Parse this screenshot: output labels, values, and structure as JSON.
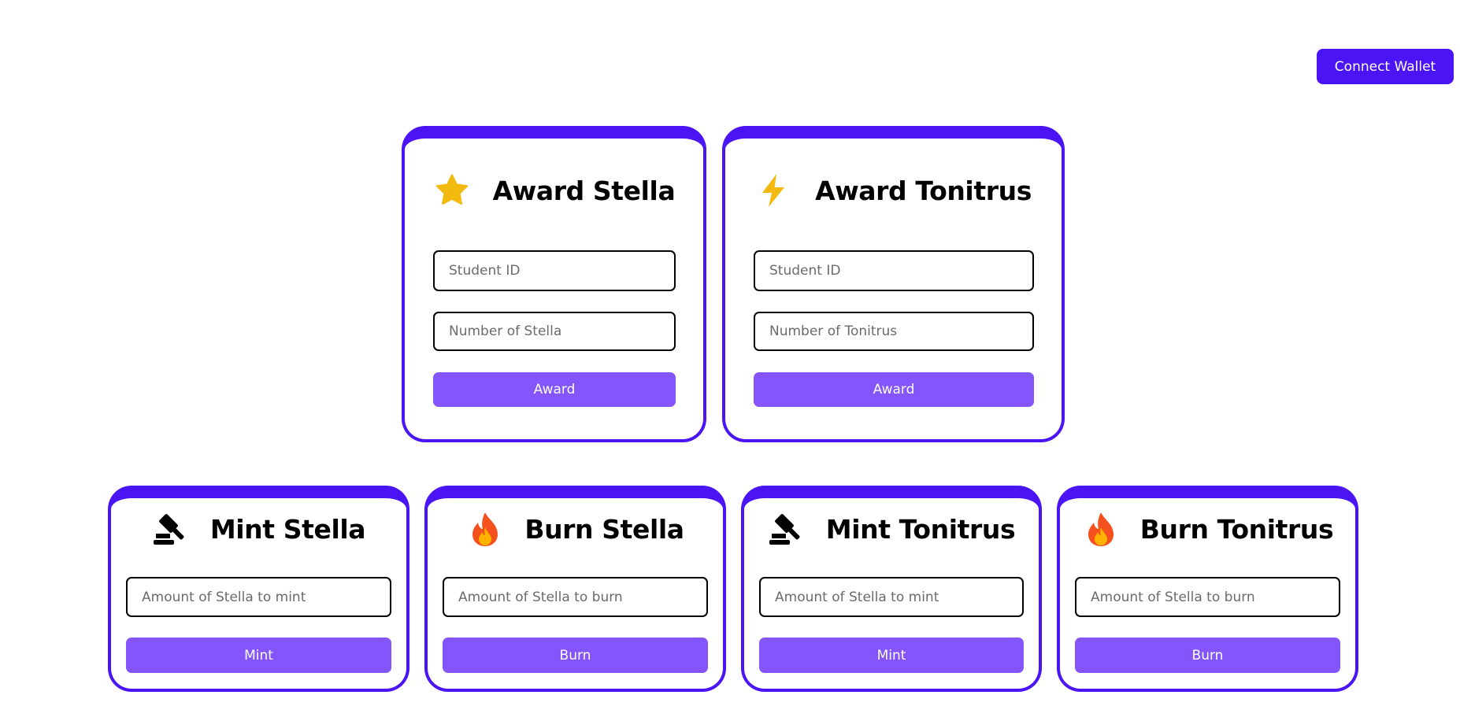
{
  "header": {
    "connect_label": "Connect Wallet"
  },
  "award_cards": [
    {
      "title": "Award Stella",
      "icon": "star-icon",
      "id_placeholder": "Student ID",
      "amount_placeholder": "Number of Stella",
      "button": "Award"
    },
    {
      "title": "Award Tonitrus",
      "icon": "lightning-icon",
      "id_placeholder": "Student ID",
      "amount_placeholder": "Number of Tonitrus",
      "button": "Award"
    }
  ],
  "token_cards": [
    {
      "title": "Mint Stella",
      "icon": "gavel-icon",
      "placeholder": "Amount of Stella to mint",
      "button": "Mint"
    },
    {
      "title": "Burn Stella",
      "icon": "fire-icon",
      "placeholder": "Amount of Stella to burn",
      "button": "Burn"
    },
    {
      "title": "Mint Tonitrus",
      "icon": "gavel-icon",
      "placeholder": "Amount of Stella to mint",
      "button": "Mint"
    },
    {
      "title": "Burn Tonitrus",
      "icon": "fire-icon",
      "placeholder": "Amount of Stella to burn",
      "button": "Burn"
    }
  ],
  "colors": {
    "primary": "#4a14f5",
    "button": "#8355fb",
    "icon_yellow": "#f2b90f",
    "fire": "#f4511e"
  }
}
